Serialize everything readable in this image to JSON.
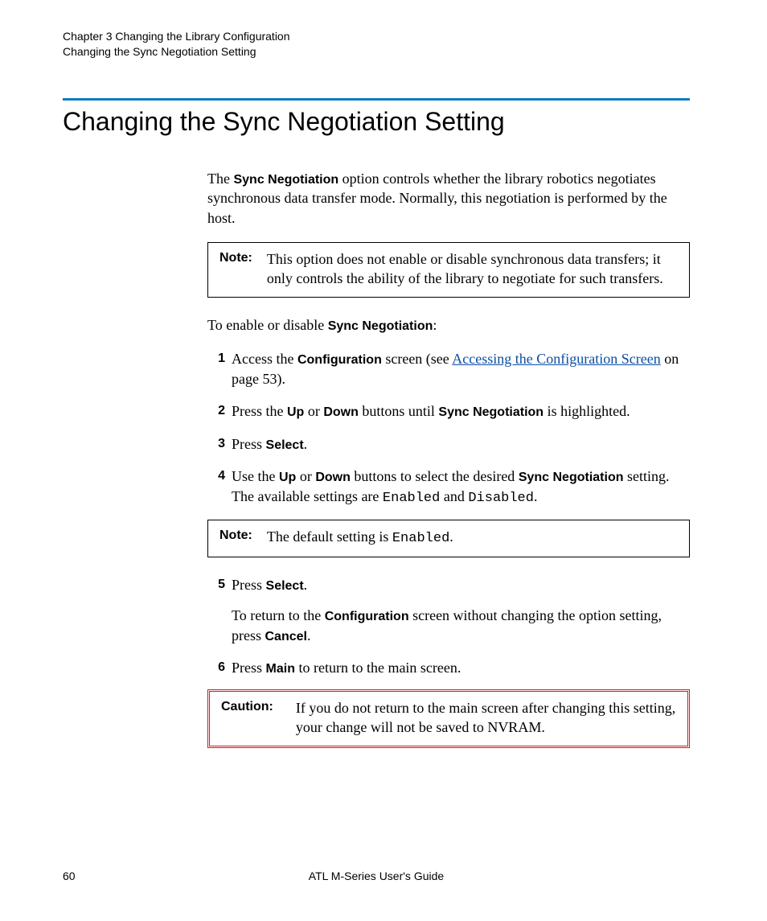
{
  "header": {
    "line1": "Chapter 3  Changing the Library Configuration",
    "line2": "Changing the Sync Negotiation Setting"
  },
  "title": "Changing the Sync Negotiation Setting",
  "intro": {
    "pre": "The ",
    "bold1": "Sync Negotiation",
    "post": " option controls whether the library robotics negotiates synchronous data transfer mode. Normally, this negotiation is performed by the host."
  },
  "note1": {
    "label": "Note:",
    "text": "This option does not enable or disable synchronous data transfers; it only controls the ability of the library to negotiate for such transfers."
  },
  "lead": {
    "pre": "To enable or disable ",
    "bold": "Sync Negotiation",
    "post": ":"
  },
  "steps": {
    "s1": {
      "num": "1",
      "t1": "Access the ",
      "b1": "Configuration",
      "t2": " screen (see ",
      "link": "Accessing the Configuration Screen",
      "t3": " on page 53)."
    },
    "s2": {
      "num": "2",
      "t1": "Press the ",
      "b1": "Up",
      "t2": " or ",
      "b2": "Down",
      "t3": " buttons until ",
      "b3": "Sync Negotiation",
      "t4": " is highlighted."
    },
    "s3": {
      "num": "3",
      "t1": "Press ",
      "b1": "Select",
      "t2": "."
    },
    "s4": {
      "num": "4",
      "t1": "Use the ",
      "b1": "Up",
      "t2": " or ",
      "b2": "Down",
      "t3": " buttons to select the desired ",
      "b3": "Sync Negotiation",
      "t4": " setting. The available settings are ",
      "m1": "Enabled",
      "t5": " and ",
      "m2": "Disabled",
      "t6": "."
    },
    "note2": {
      "label": "Note:",
      "t1": "The default setting is ",
      "m1": "Enabled",
      "t2": "."
    },
    "s5": {
      "num": "5",
      "t1": "Press ",
      "b1": "Select",
      "t2": ".",
      "extra_t1": "To return to the ",
      "extra_b1": "Configuration",
      "extra_t2": " screen without changing the option setting, press ",
      "extra_b2": "Cancel",
      "extra_t3": "."
    },
    "s6": {
      "num": "6",
      "t1": "Press ",
      "b1": "Main",
      "t2": " to return to the main screen."
    },
    "caution": {
      "label": "Caution:",
      "text": "If you do not return to the main screen after changing this setting, your change will not be saved to NVRAM."
    }
  },
  "footer": {
    "page": "60",
    "title": "ATL M-Series User's Guide"
  }
}
